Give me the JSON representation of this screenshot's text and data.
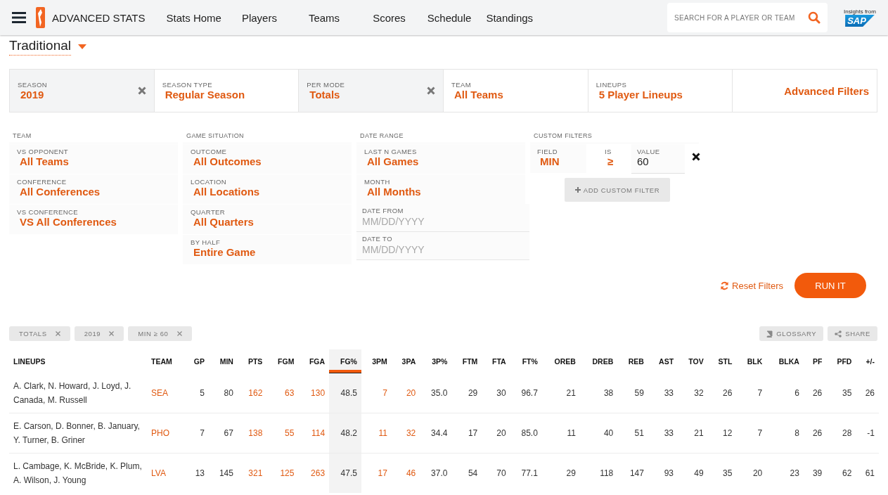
{
  "header": {
    "brand": "ADVANCED STATS",
    "nav": [
      {
        "label": "Stats Home"
      },
      {
        "label": "Players"
      },
      {
        "label": "Teams"
      },
      {
        "label": "Scores"
      },
      {
        "label": "Schedule"
      },
      {
        "label": "Standings"
      }
    ],
    "search": {
      "placeholder": "SEARCH FOR A PLAYER OR TEAM"
    },
    "sponsor": {
      "caption": "Insights from",
      "logo": "SAP"
    }
  },
  "measure": {
    "label": "Traditional"
  },
  "filter_bar": [
    {
      "label": "SEASON",
      "value": "2019",
      "clearable": true
    },
    {
      "label": "SEASON TYPE",
      "value": "Regular Season",
      "clearable": false
    },
    {
      "label": "PER MODE",
      "value": "Totals",
      "clearable": true
    },
    {
      "label": "TEAM",
      "value": "All Teams",
      "clearable": false
    },
    {
      "label": "LINEUPS",
      "value": "5 Player Lineups",
      "clearable": false
    }
  ],
  "advanced_filters": "Advanced Filters",
  "groups": [
    {
      "title": "TEAM",
      "filters": [
        {
          "kind": "select",
          "label": "VS OPPONENT",
          "value": "All Teams"
        },
        {
          "kind": "select",
          "label": "CONFERENCE",
          "value": "All Conferences"
        },
        {
          "kind": "select",
          "label": "VS CONFERENCE",
          "value": "VS All Conferences"
        }
      ]
    },
    {
      "title": "GAME SITUATION",
      "filters": [
        {
          "kind": "select",
          "label": "OUTCOME",
          "value": "All Outcomes"
        },
        {
          "kind": "select",
          "label": "LOCATION",
          "value": "All Locations"
        },
        {
          "kind": "select",
          "label": "QUARTER",
          "value": "All Quarters"
        },
        {
          "kind": "select",
          "label": "BY HALF",
          "value": "Entire Game"
        }
      ]
    },
    {
      "title": "DATE RANGE",
      "filters": [
        {
          "kind": "select",
          "label": "LAST N GAMES",
          "value": "All Games"
        },
        {
          "kind": "select",
          "label": "MONTH",
          "value": "All Months"
        },
        {
          "kind": "date",
          "label": "DATE FROM",
          "placeholder": "MM/DD/YYYY"
        },
        {
          "kind": "date",
          "label": "DATE TO",
          "placeholder": "MM/DD/YYYY"
        }
      ]
    }
  ],
  "custom_filters": {
    "title": "CUSTOM FILTERS",
    "field_label": "FIELD",
    "field": "MIN",
    "is_label": "IS",
    "operator": "≥",
    "value_label": "VALUE",
    "value": "60",
    "add_button": "ADD CUSTOM FILTER"
  },
  "actions": {
    "reset": "Reset Filters",
    "run": "RUN IT"
  },
  "chips": [
    {
      "label": "TOTALS"
    },
    {
      "label": "2019"
    },
    {
      "label": "MIN ≥ 60"
    }
  ],
  "tools": {
    "glossary": "GLOSSARY",
    "share": "SHARE"
  },
  "table": {
    "columns": [
      {
        "label": "LINEUPS",
        "kind": "text",
        "selected": false
      },
      {
        "label": "TEAM",
        "kind": "link",
        "selected": false
      },
      {
        "label": "GP",
        "kind": "number",
        "selected": false
      },
      {
        "label": "MIN",
        "kind": "number",
        "selected": false
      },
      {
        "label": "PTS",
        "kind": "link",
        "selected": false
      },
      {
        "label": "FGM",
        "kind": "link",
        "selected": false
      },
      {
        "label": "FGA",
        "kind": "link",
        "selected": false
      },
      {
        "label": "FG%",
        "kind": "number",
        "selected": true
      },
      {
        "label": "3PM",
        "kind": "link",
        "selected": false
      },
      {
        "label": "3PA",
        "kind": "link",
        "selected": false
      },
      {
        "label": "3P%",
        "kind": "number",
        "selected": false
      },
      {
        "label": "FTM",
        "kind": "number",
        "selected": false
      },
      {
        "label": "FTA",
        "kind": "number",
        "selected": false
      },
      {
        "label": "FT%",
        "kind": "number",
        "selected": false
      },
      {
        "label": "OREB",
        "kind": "number",
        "selected": false
      },
      {
        "label": "DREB",
        "kind": "number",
        "selected": false
      },
      {
        "label": "REB",
        "kind": "number",
        "selected": false
      },
      {
        "label": "AST",
        "kind": "number",
        "selected": false
      },
      {
        "label": "TOV",
        "kind": "number",
        "selected": false
      },
      {
        "label": "STL",
        "kind": "number",
        "selected": false
      },
      {
        "label": "BLK",
        "kind": "number",
        "selected": false
      },
      {
        "label": "BLKA",
        "kind": "number",
        "selected": false
      },
      {
        "label": "PF",
        "kind": "number",
        "selected": false
      },
      {
        "label": "PFD",
        "kind": "number",
        "selected": false
      },
      {
        "label": "+/-",
        "kind": "number",
        "selected": false
      }
    ],
    "rows": [
      [
        "A. Clark, N. Howard, J. Loyd, J. Canada, M. Russell",
        "SEA",
        "5",
        "80",
        "162",
        "63",
        "130",
        "48.5",
        "7",
        "20",
        "35.0",
        "29",
        "30",
        "96.7",
        "21",
        "38",
        "59",
        "33",
        "32",
        "26",
        "7",
        "6",
        "26",
        "35",
        "26"
      ],
      [
        "E. Carson, D. Bonner, B. January, Y. Turner, B. Griner",
        "PHO",
        "7",
        "67",
        "138",
        "55",
        "114",
        "48.2",
        "11",
        "32",
        "34.4",
        "17",
        "20",
        "85.0",
        "11",
        "40",
        "51",
        "33",
        "21",
        "12",
        "7",
        "8",
        "26",
        "28",
        "-1"
      ],
      [
        "L. Cambage, K. McBride, K. Plum, A. Wilson, J. Young",
        "LVA",
        "13",
        "145",
        "321",
        "125",
        "263",
        "47.5",
        "17",
        "46",
        "37.0",
        "54",
        "70",
        "77.1",
        "29",
        "118",
        "147",
        "93",
        "49",
        "35",
        "20",
        "23",
        "39",
        "62",
        "61"
      ]
    ]
  }
}
